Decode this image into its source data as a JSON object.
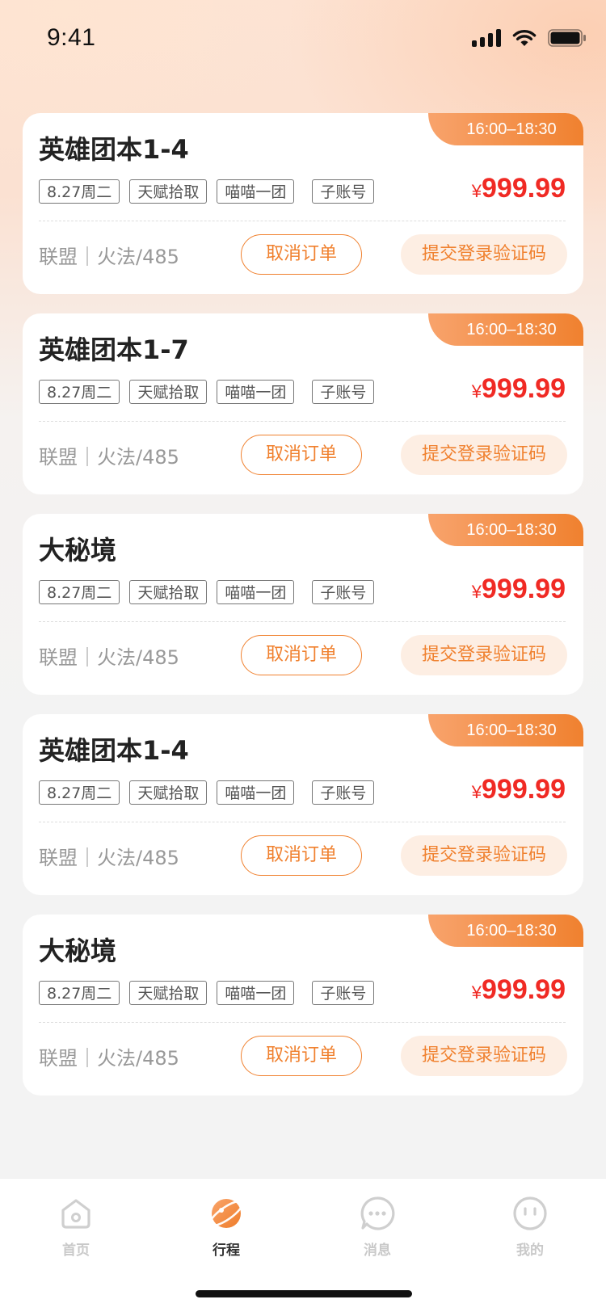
{
  "status_bar": {
    "time": "9:41"
  },
  "orders": [
    {
      "time_range": "16:00–18:30",
      "title": "英雄团本1-4",
      "tags": [
        "8.27周二",
        "天赋拾取",
        "喵喵一团",
        "子账号"
      ],
      "currency": "¥",
      "price": "999.99",
      "meta": "联盟｜火法/485",
      "cancel_label": "取消订单",
      "submit_label": "提交登录验证码"
    },
    {
      "time_range": "16:00–18:30",
      "title": "英雄团本1-7",
      "tags": [
        "8.27周二",
        "天赋拾取",
        "喵喵一团",
        "子账号"
      ],
      "currency": "¥",
      "price": "999.99",
      "meta": "联盟｜火法/485",
      "cancel_label": "取消订单",
      "submit_label": "提交登录验证码"
    },
    {
      "time_range": "16:00–18:30",
      "title": "大秘境",
      "tags": [
        "8.27周二",
        "天赋拾取",
        "喵喵一团",
        "子账号"
      ],
      "currency": "¥",
      "price": "999.99",
      "meta": "联盟｜火法/485",
      "cancel_label": "取消订单",
      "submit_label": "提交登录验证码"
    },
    {
      "time_range": "16:00–18:30",
      "title": "英雄团本1-4",
      "tags": [
        "8.27周二",
        "天赋拾取",
        "喵喵一团",
        "子账号"
      ],
      "currency": "¥",
      "price": "999.99",
      "meta": "联盟｜火法/485",
      "cancel_label": "取消订单",
      "submit_label": "提交登录验证码"
    },
    {
      "time_range": "16:00–18:30",
      "title": "大秘境",
      "tags": [
        "8.27周二",
        "天赋拾取",
        "喵喵一团",
        "子账号"
      ],
      "currency": "¥",
      "price": "999.99",
      "meta": "联盟｜火法/485",
      "cancel_label": "取消订单",
      "submit_label": "提交登录验证码"
    }
  ],
  "tab_bar": {
    "items": [
      {
        "label": "首页",
        "icon": "home-icon",
        "active": false
      },
      {
        "label": "行程",
        "icon": "planet-icon",
        "active": true
      },
      {
        "label": "消息",
        "icon": "chat-icon",
        "active": false
      },
      {
        "label": "我的",
        "icon": "profile-face-icon",
        "active": false
      }
    ]
  },
  "colors": {
    "accent": "#f0812f",
    "price": "#f02a24",
    "inactive_tab": "#c9c9c9"
  }
}
